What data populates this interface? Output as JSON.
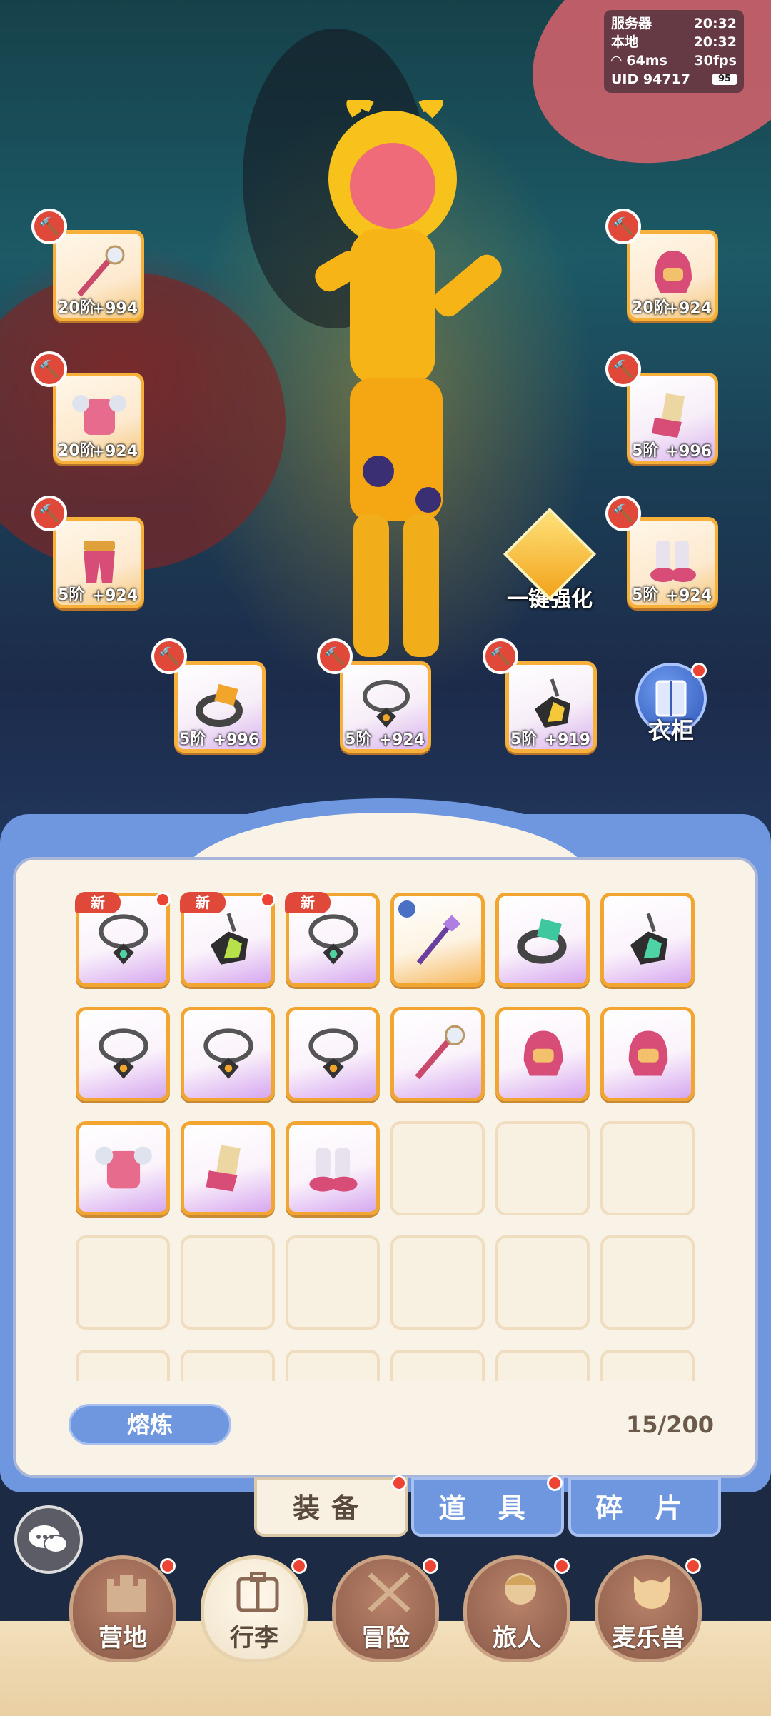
{
  "status": {
    "server_label": "服务器",
    "server_time": "20:32",
    "local_label": "本地",
    "local_time": "20:32",
    "ping": "64ms",
    "fps": "30fps",
    "uid_label": "UID",
    "uid": "94717",
    "battery": "95"
  },
  "equipped": [
    {
      "name": "staff",
      "level": "20阶",
      "bonus": "+994"
    },
    {
      "name": "helmet",
      "level": "20阶",
      "bonus": "+924"
    },
    {
      "name": "armor",
      "level": "20阶",
      "bonus": "+924"
    },
    {
      "name": "gloves",
      "level": "5阶",
      "bonus": "+996"
    },
    {
      "name": "pants",
      "level": "5阶",
      "bonus": "+924"
    },
    {
      "name": "boots",
      "level": "5阶",
      "bonus": "+924"
    },
    {
      "name": "ring",
      "level": "5阶",
      "bonus": "+996"
    },
    {
      "name": "necklace",
      "level": "5阶",
      "bonus": "+924"
    },
    {
      "name": "amulet",
      "level": "5阶",
      "bonus": "+919"
    }
  ],
  "enhance_label": "一键强化",
  "wardrobe_label": "衣柜",
  "inventory": {
    "new_tag": "新",
    "smelt_label": "熔炼",
    "count": "15/200"
  },
  "tabs": [
    "装备",
    "道 具",
    "碎 片"
  ],
  "nav": [
    "营地",
    "行李",
    "冒险",
    "旅人",
    "麦乐兽"
  ],
  "colors": {
    "accent_blue": "#6f97e0",
    "slot_orange": "#f3a531",
    "badge_red": "#e0483a"
  }
}
